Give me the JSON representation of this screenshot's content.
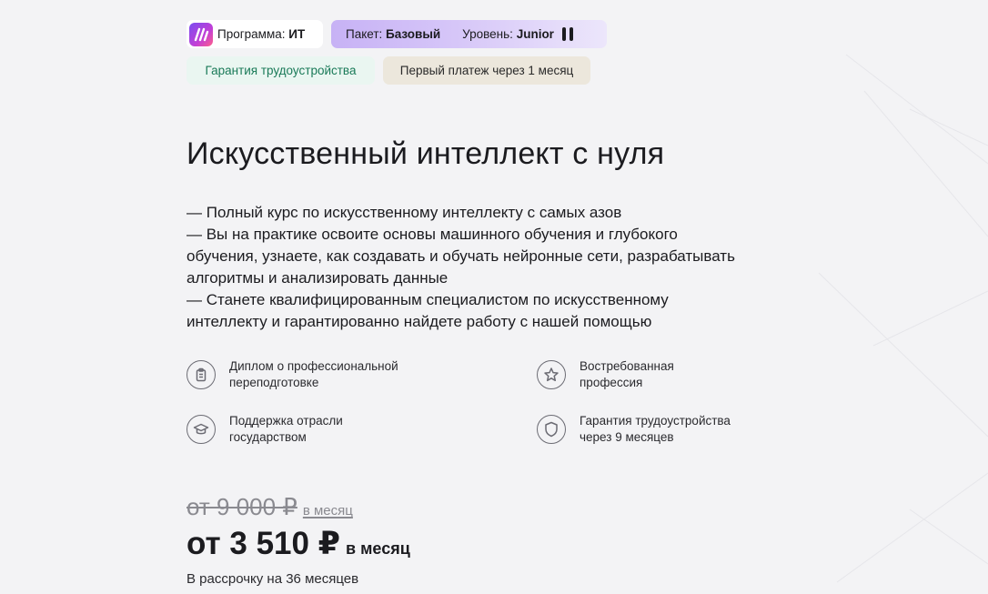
{
  "tags": {
    "program_label": "Программа:",
    "program_value": "ИТ",
    "package_label": "Пакет:",
    "package_value": "Базовый",
    "level_label": "Уровень:",
    "level_value": "Junior",
    "guarantee": "Гарантия трудоустройства",
    "first_payment": "Первый платеж через 1 месяц"
  },
  "title": "Искусственный интеллект с нуля",
  "description": [
    "— Полный курс по искусственному интеллекту с самых азов",
    "— Вы на практике освоите основы машинного обучения и глубокого обучения, узнаете, как создавать и обучать нейронные сети, разрабатывать алгоритмы и анализировать данные",
    "— Станете квалифицированным специалистом по искусственному интеллекту и гарантированно найдете работу с нашей помощью"
  ],
  "features": [
    {
      "icon": "clipboard-icon",
      "text": "Диплом о профессиональной переподготовке"
    },
    {
      "icon": "star-icon",
      "text": "Востребованная профессия"
    },
    {
      "icon": "graduation-cap-icon",
      "text": "Поддержка отрасли государством"
    },
    {
      "icon": "shield-icon",
      "text": "Гарантия трудоустройства через 9 месяцев"
    }
  ],
  "pricing": {
    "old_price": "от 9 000 ₽",
    "old_suffix": "в месяц",
    "price": "от 3 510 ₽",
    "price_suffix": "в месяц",
    "installment": "В рассрочку на 36 месяцев"
  },
  "colors": {
    "background": "#f3f3f5",
    "accent_purple": "#c7b2f5",
    "guarantee_green": "#1a7a58",
    "beige_tag": "#ece7dc"
  }
}
